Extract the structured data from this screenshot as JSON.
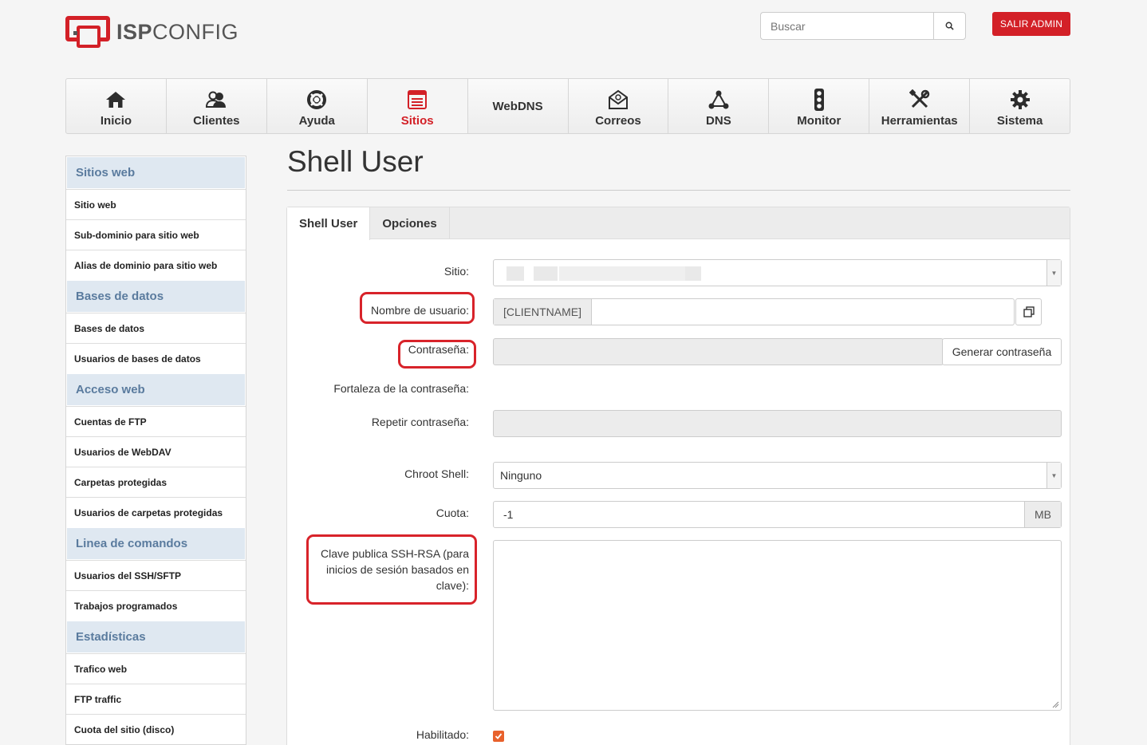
{
  "header": {
    "logo_bold": "ISP",
    "logo_light": "CONFIG",
    "search_placeholder": "Buscar",
    "logout_label": "SALIR ADMIN"
  },
  "nav": {
    "items": [
      {
        "label": "Inicio",
        "icon": "home-icon"
      },
      {
        "label": "Clientes",
        "icon": "users-icon"
      },
      {
        "label": "Ayuda",
        "icon": "lifebuoy-icon"
      },
      {
        "label": "Sitios",
        "icon": "browser-icon",
        "active": true
      },
      {
        "label": "WebDNS",
        "icon": ""
      },
      {
        "label": "Correos",
        "icon": "envelope-at-icon"
      },
      {
        "label": "DNS",
        "icon": "network-icon"
      },
      {
        "label": "Monitor",
        "icon": "traffic-light-icon"
      },
      {
        "label": "Herramientas",
        "icon": "tools-icon"
      },
      {
        "label": "Sistema",
        "icon": "gear-icon"
      }
    ]
  },
  "sidebar": {
    "sections": [
      {
        "title": "Sitios web",
        "items": [
          "Sitio web",
          "Sub-dominio para sitio web",
          "Alias de dominio para sitio web"
        ]
      },
      {
        "title": "Bases de datos",
        "items": [
          "Bases de datos",
          "Usuarios de bases de datos"
        ]
      },
      {
        "title": "Acceso web",
        "items": [
          "Cuentas de FTP",
          "Usuarios de WebDAV",
          "Carpetas protegidas",
          "Usuarios de carpetas protegidas"
        ]
      },
      {
        "title": "Linea de comandos",
        "items": [
          "Usuarios del SSH/SFTP",
          "Trabajos programados"
        ]
      },
      {
        "title": "Estadísticas",
        "items": [
          "Trafico web",
          "FTP traffic",
          "Cuota del sitio (disco)"
        ]
      }
    ]
  },
  "page": {
    "title": "Shell User",
    "tabs": [
      "Shell User",
      "Opciones"
    ]
  },
  "form": {
    "site_label": "Sitio:",
    "username_label": "Nombre de usuario:",
    "username_prefix": "[CLIENTNAME]",
    "password_label": "Contraseña:",
    "generate_password_label": "Generar contraseña",
    "strength_label": "Fortaleza de la contraseña:",
    "repeat_password_label": "Repetir contraseña:",
    "chroot_label": "Chroot Shell:",
    "chroot_value": "Ninguno",
    "quota_label": "Cuota:",
    "quota_value": "-1",
    "quota_unit": "MB",
    "ssh_key_label_line1": "Clave publica SSH-RSA (para",
    "ssh_key_label_line2": "inicios de sesión basados en",
    "ssh_key_label_line3": "clave):",
    "enabled_label": "Habilitado:",
    "enabled_checked": true
  },
  "colors": {
    "brand_red": "#d32027",
    "sidebar_header_bg": "#dfe8f1",
    "sidebar_header_text": "#5a7b9e",
    "checkbox_orange": "#e8612c"
  }
}
